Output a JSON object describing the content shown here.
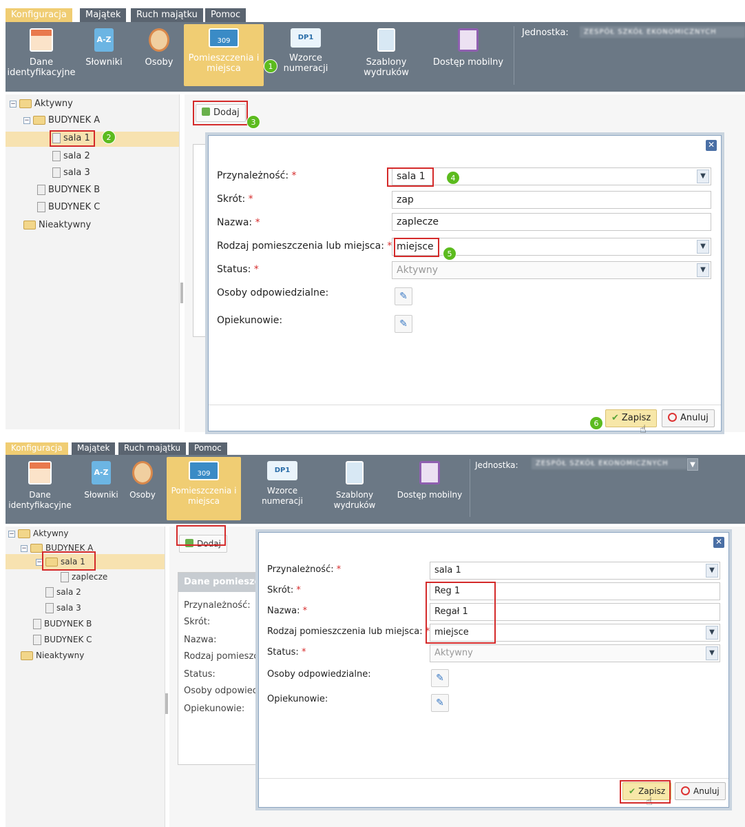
{
  "menu": [
    "Konfiguracja",
    "Majątek",
    "Ruch majątku",
    "Pomoc"
  ],
  "ribbon": {
    "buttons": [
      {
        "label": "Dane identyfikacyjne",
        "icon": "building-icon"
      },
      {
        "label": "Słowniki",
        "icon": "dictionary-icon"
      },
      {
        "label": "Osoby",
        "icon": "person-icon"
      },
      {
        "label": "Pomieszczenia i miejsca",
        "icon": "room-icon",
        "icon_text": "309"
      },
      {
        "label": "Wzorce numeracji",
        "icon": "numbering-icon",
        "icon_text": "DP1"
      },
      {
        "label": "Szablony wydruków",
        "icon": "print-template-icon"
      },
      {
        "label": "Dostęp mobilny",
        "icon": "mobile-access-icon"
      }
    ],
    "unit_label": "Jednostka:",
    "unit_value": "ZESPÓŁ SZKÓŁ EKONOMICZNYCH"
  },
  "tree1": [
    "Aktywny",
    "BUDYNEK A",
    "sala 1",
    "sala 2",
    "sala 3",
    "BUDYNEK B",
    "BUDYNEK C",
    "Nieaktywny"
  ],
  "tree2": [
    "Aktywny",
    "BUDYNEK A",
    "sala 1",
    "zaplecze",
    "sala 2",
    "sala 3",
    "BUDYNEK B",
    "BUDYNEK C",
    "Nieaktywny"
  ],
  "add_label": "Dodaj",
  "bg_panel": {
    "title": "Dane pomieszcz",
    "labels": [
      "Przynależność:",
      "Skrót:",
      "Nazwa:",
      "Rodzaj pomieszcz",
      "Status:",
      "Osoby odpowiedz",
      "Opiekunowie:"
    ]
  },
  "form_labels": {
    "belongs": "Przynależność:",
    "short": "Skrót:",
    "name": "Nazwa:",
    "type": "Rodzaj pomieszczenia lub miejsca:",
    "status": "Status:",
    "responsible": "Osoby odpowiedzialne:",
    "guardians": "Opiekunowie:",
    "required_mark": "*"
  },
  "dialog1": {
    "belongs": "sala 1",
    "short": "zap",
    "name": "zaplecze",
    "type": "miejsce",
    "status": "Aktywny"
  },
  "dialog2": {
    "belongs": "sala 1",
    "short": "Reg 1",
    "name": "Regał 1",
    "type": "miejsce",
    "status": "Aktywny"
  },
  "buttons": {
    "save": "Zapisz",
    "cancel": "Anuluj",
    "close": "✕"
  },
  "badges": [
    "1",
    "2",
    "3",
    "4",
    "5",
    "6"
  ],
  "colors": {
    "accent": "#f0cd73",
    "ribbon": "#6b7885",
    "annotation_red": "#d42a2a",
    "badge_green": "#5cbb1e"
  }
}
